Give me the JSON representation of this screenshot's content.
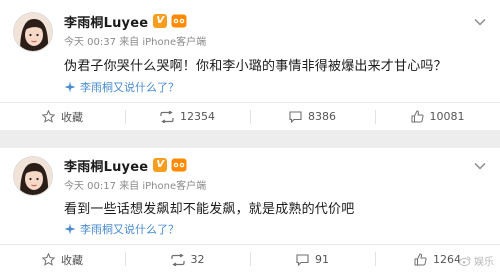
{
  "posts": [
    {
      "username": "李雨桐Luyee",
      "vip_badge": "V",
      "time": "今天 00:37",
      "source": "来自 iPhone客户端",
      "content": "伪君子你哭什么哭啊！你和李小璐的事情非得被爆出来才甘心吗？",
      "topic_link": "李雨桐又说什么了？",
      "actions": {
        "favorite_label": "收藏",
        "repost_count": "12354",
        "comment_count": "8386",
        "like_count": "10081"
      }
    },
    {
      "username": "李雨桐Luyee",
      "vip_badge": "V",
      "time": "今天 00:17",
      "source": "来自 iPhone客户端",
      "content": "看到一些话想发飙却不能发飙，就是成熟的代价吧",
      "topic_link": "李雨桐又说什么了？",
      "actions": {
        "favorite_label": "收藏",
        "repost_count": "32",
        "comment_count": "91",
        "like_count": "1264"
      }
    }
  ],
  "watermark": "娱乐",
  "colors": {
    "link": "#4a8ccc",
    "vip": "#f59d1f",
    "background": "#ededed"
  }
}
